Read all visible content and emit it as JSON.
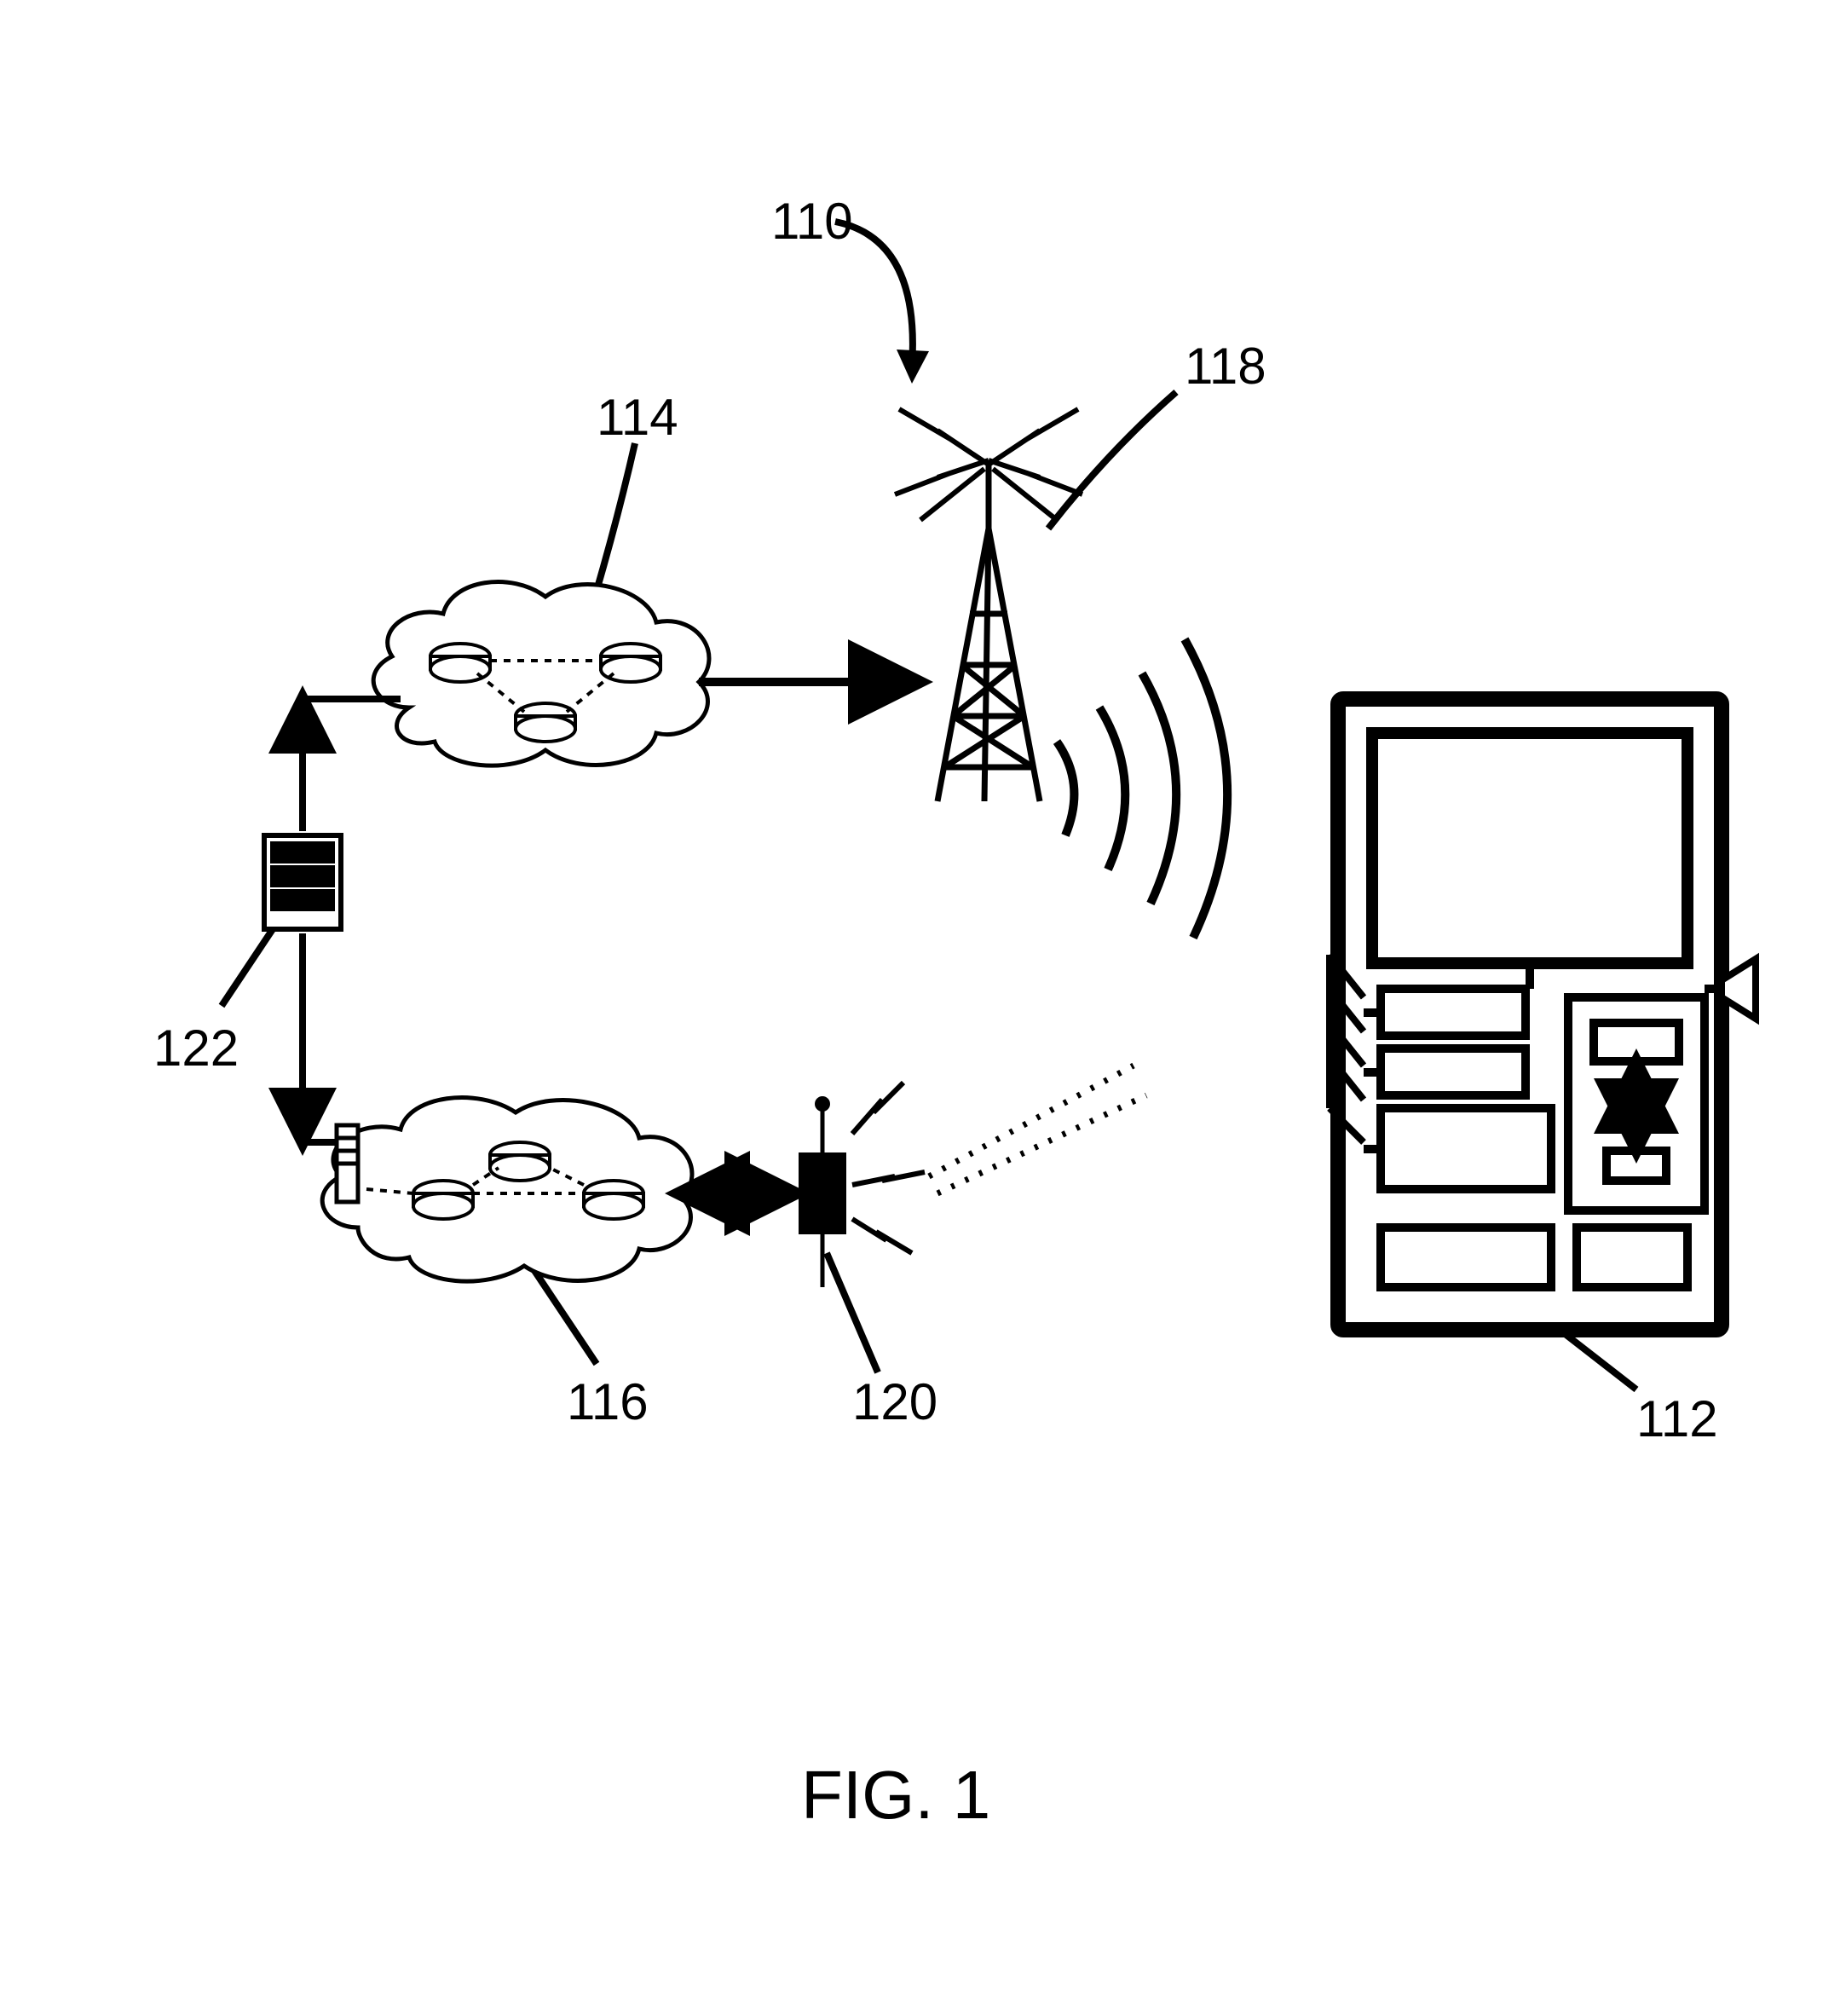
{
  "labels": {
    "ref_110": "110",
    "ref_114": "114",
    "ref_118": "118",
    "ref_122": "122",
    "ref_116": "116",
    "ref_120": "120",
    "ref_112": "112"
  },
  "caption": "FIG. 1",
  "colors": {
    "stroke": "#000000",
    "fill_white": "#ffffff"
  }
}
